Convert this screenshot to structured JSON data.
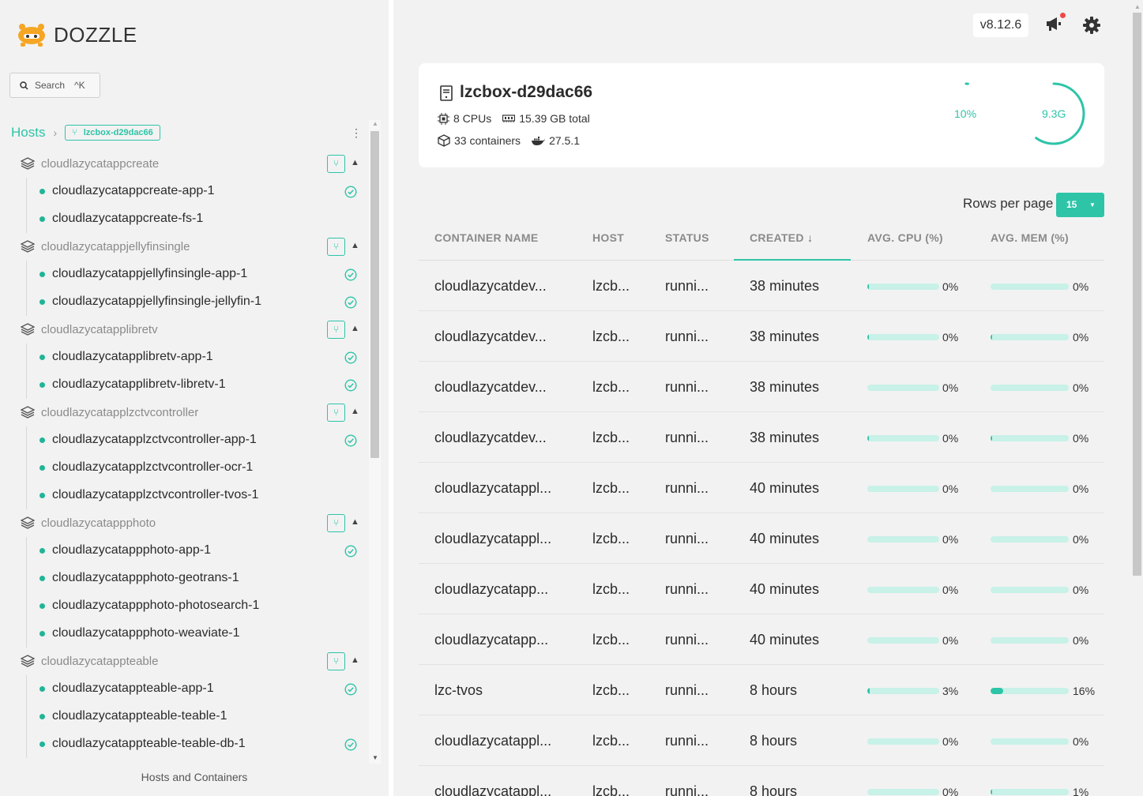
{
  "app": {
    "name": "DOZZLE",
    "version": "v8.12.6"
  },
  "search": {
    "placeholder": "Search",
    "shortcut": "^K"
  },
  "breadcrumb": {
    "root": "Hosts",
    "current": "lzcbox-d29dac66"
  },
  "sidebar": {
    "footer": "Hosts and Containers",
    "groups": [
      {
        "name": "cloudlazycatappcreate",
        "items": [
          {
            "name": "cloudlazycatappcreate-app-1",
            "healthy": true
          },
          {
            "name": "cloudlazycatappcreate-fs-1",
            "healthy": false
          }
        ]
      },
      {
        "name": "cloudlazycatappjellyfinsingle",
        "items": [
          {
            "name": "cloudlazycatappjellyfinsingle-app-1",
            "healthy": true
          },
          {
            "name": "cloudlazycatappjellyfinsingle-jellyfin-1",
            "healthy": true
          }
        ]
      },
      {
        "name": "cloudlazycatapplibretv",
        "items": [
          {
            "name": "cloudlazycatapplibretv-app-1",
            "healthy": true
          },
          {
            "name": "cloudlazycatapplibretv-libretv-1",
            "healthy": true
          }
        ]
      },
      {
        "name": "cloudlazycatapplzctvcontroller",
        "items": [
          {
            "name": "cloudlazycatapplzctvcontroller-app-1",
            "healthy": true
          },
          {
            "name": "cloudlazycatapplzctvcontroller-ocr-1",
            "healthy": false
          },
          {
            "name": "cloudlazycatapplzctvcontroller-tvos-1",
            "healthy": false
          }
        ]
      },
      {
        "name": "cloudlazycatappphoto",
        "items": [
          {
            "name": "cloudlazycatappphoto-app-1",
            "healthy": true
          },
          {
            "name": "cloudlazycatappphoto-geotrans-1",
            "healthy": false
          },
          {
            "name": "cloudlazycatappphoto-photosearch-1",
            "healthy": false
          },
          {
            "name": "cloudlazycatappphoto-weaviate-1",
            "healthy": false
          }
        ]
      },
      {
        "name": "cloudlazycatappteable",
        "items": [
          {
            "name": "cloudlazycatappteable-app-1",
            "healthy": true
          },
          {
            "name": "cloudlazycatappteable-teable-1",
            "healthy": false
          },
          {
            "name": "cloudlazycatappteable-teable-db-1",
            "healthy": true
          }
        ]
      }
    ]
  },
  "host": {
    "name": "lzcbox-d29dac66",
    "cpus": "8 CPUs",
    "memory": "15.39 GB total",
    "containers": "33 containers",
    "docker_version": "27.5.1",
    "cpu_metric": "10%",
    "mem_metric": "9.3G",
    "cpu_fraction": 0.1,
    "mem_fraction": 0.6
  },
  "table": {
    "rows_per_page_label": "Rows per page",
    "rows_per_page": "15",
    "sorted_column": "CREATED",
    "headers": [
      "CONTAINER NAME",
      "HOST",
      "STATUS",
      "CREATED",
      "AVG. CPU (%)",
      "AVG. MEM (%)"
    ],
    "rows": [
      {
        "name": "cloudlazycatdev...",
        "host": "lzcb...",
        "status": "runni...",
        "created": "38 minutes",
        "cpu": "0%",
        "mem": "0%",
        "cpu_frac": 0.01,
        "mem_frac": 0.0
      },
      {
        "name": "cloudlazycatdev...",
        "host": "lzcb...",
        "status": "runni...",
        "created": "38 minutes",
        "cpu": "0%",
        "mem": "0%",
        "cpu_frac": 0.01,
        "mem_frac": 0.01
      },
      {
        "name": "cloudlazycatdev...",
        "host": "lzcb...",
        "status": "runni...",
        "created": "38 minutes",
        "cpu": "0%",
        "mem": "0%",
        "cpu_frac": 0.0,
        "mem_frac": 0.0
      },
      {
        "name": "cloudlazycatdev...",
        "host": "lzcb...",
        "status": "runni...",
        "created": "38 minutes",
        "cpu": "0%",
        "mem": "0%",
        "cpu_frac": 0.01,
        "mem_frac": 0.01
      },
      {
        "name": "cloudlazycatappl...",
        "host": "lzcb...",
        "status": "runni...",
        "created": "40 minutes",
        "cpu": "0%",
        "mem": "0%",
        "cpu_frac": 0.0,
        "mem_frac": 0.0
      },
      {
        "name": "cloudlazycatappl...",
        "host": "lzcb...",
        "status": "runni...",
        "created": "40 minutes",
        "cpu": "0%",
        "mem": "0%",
        "cpu_frac": 0.0,
        "mem_frac": 0.0
      },
      {
        "name": "cloudlazycatapp...",
        "host": "lzcb...",
        "status": "runni...",
        "created": "40 minutes",
        "cpu": "0%",
        "mem": "0%",
        "cpu_frac": 0.0,
        "mem_frac": 0.0
      },
      {
        "name": "cloudlazycatapp...",
        "host": "lzcb...",
        "status": "runni...",
        "created": "40 minutes",
        "cpu": "0%",
        "mem": "0%",
        "cpu_frac": 0.0,
        "mem_frac": 0.0
      },
      {
        "name": "lzc-tvos",
        "host": "lzcb...",
        "status": "runni...",
        "created": "8 hours",
        "cpu": "3%",
        "mem": "16%",
        "cpu_frac": 0.03,
        "mem_frac": 0.16
      },
      {
        "name": "cloudlazycatappl...",
        "host": "lzcb...",
        "status": "runni...",
        "created": "8 hours",
        "cpu": "0%",
        "mem": "0%",
        "cpu_frac": 0.0,
        "mem_frac": 0.0
      },
      {
        "name": "cloudlazycatappl...",
        "host": "lzcb...",
        "status": "runni...",
        "created": "8 hours",
        "cpu": "0%",
        "mem": "1%",
        "cpu_frac": 0.0,
        "mem_frac": 0.01
      }
    ]
  }
}
